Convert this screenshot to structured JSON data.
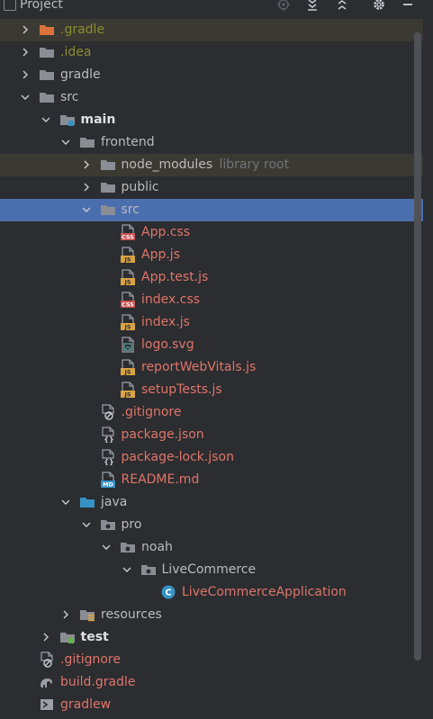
{
  "header": {
    "title": "Project",
    "icons": [
      "locate-icon",
      "expand-all-icon",
      "collapse-all-icon",
      "settings-icon",
      "hide-icon"
    ]
  },
  "tree": [
    {
      "label": ".gradle",
      "icon": "folder-orange-icon",
      "chevron": "collapsed",
      "color": "olive",
      "excluded": true
    },
    {
      "label": ".idea",
      "icon": "folder-icon",
      "chevron": "collapsed",
      "color": "olive"
    },
    {
      "label": "gradle",
      "icon": "folder-icon",
      "chevron": "collapsed",
      "color": "default"
    },
    {
      "label": "src",
      "icon": "folder-icon",
      "chevron": "expanded",
      "color": "default"
    },
    {
      "label": "main",
      "icon": "source-folder-icon",
      "chevron": "expanded",
      "color": "white",
      "bold": true
    },
    {
      "label": "frontend",
      "icon": "folder-icon",
      "chevron": "expanded",
      "color": "default"
    },
    {
      "label": "node_modules",
      "hint": "library root",
      "icon": "folder-icon",
      "chevron": "collapsed",
      "color": "default",
      "excluded": true
    },
    {
      "label": "public",
      "icon": "folder-icon",
      "chevron": "collapsed",
      "color": "default"
    },
    {
      "label": "src",
      "icon": "folder-icon",
      "chevron": "expanded",
      "color": "default",
      "selected": true
    },
    {
      "label": "App.css",
      "icon": "css-file-icon",
      "color": "red"
    },
    {
      "label": "App.js",
      "icon": "js-file-icon",
      "color": "red"
    },
    {
      "label": "App.test.js",
      "icon": "js-file-icon",
      "color": "red"
    },
    {
      "label": "index.css",
      "icon": "css-file-icon",
      "color": "red"
    },
    {
      "label": "index.js",
      "icon": "js-file-icon",
      "color": "red"
    },
    {
      "label": "logo.svg",
      "icon": "svg-file-icon",
      "color": "red"
    },
    {
      "label": "reportWebVitals.js",
      "icon": "js-file-icon",
      "color": "red"
    },
    {
      "label": "setupTests.js",
      "icon": "js-file-icon",
      "color": "red"
    },
    {
      "label": ".gitignore",
      "icon": "ignore-file-icon",
      "color": "red"
    },
    {
      "label": "package.json",
      "icon": "json-file-icon",
      "color": "red"
    },
    {
      "label": "package-lock.json",
      "icon": "json-file-icon",
      "color": "red"
    },
    {
      "label": "README.md",
      "icon": "markdown-file-icon",
      "color": "red"
    },
    {
      "label": "java",
      "icon": "source-folder-blue-icon",
      "chevron": "expanded",
      "color": "default"
    },
    {
      "label": "pro",
      "icon": "package-icon",
      "chevron": "expanded",
      "color": "default"
    },
    {
      "label": "noah",
      "icon": "package-icon",
      "chevron": "expanded",
      "color": "default"
    },
    {
      "label": "LiveCommerce",
      "icon": "package-icon",
      "chevron": "expanded",
      "color": "default"
    },
    {
      "label": "LiveCommerceApplication",
      "icon": "java-class-icon",
      "color": "red"
    },
    {
      "label": "resources",
      "icon": "resources-folder-icon",
      "chevron": "collapsed",
      "color": "default"
    },
    {
      "label": "test",
      "icon": "test-folder-icon",
      "chevron": "collapsed",
      "color": "white",
      "bold": true
    },
    {
      "label": ".gitignore",
      "icon": "ignore-file-icon",
      "color": "red"
    },
    {
      "label": "build.gradle",
      "icon": "gradle-elephant-icon",
      "color": "red"
    },
    {
      "label": "gradlew",
      "icon": "script-file-icon",
      "color": "red"
    }
  ],
  "colors": {
    "background": "#2b2d30",
    "selection": "#4b6eaf",
    "excluded": "#3b3a32",
    "default_text": "#bbbbbb",
    "red_text": "#e0756a",
    "olive_text": "#8c8c2f"
  }
}
